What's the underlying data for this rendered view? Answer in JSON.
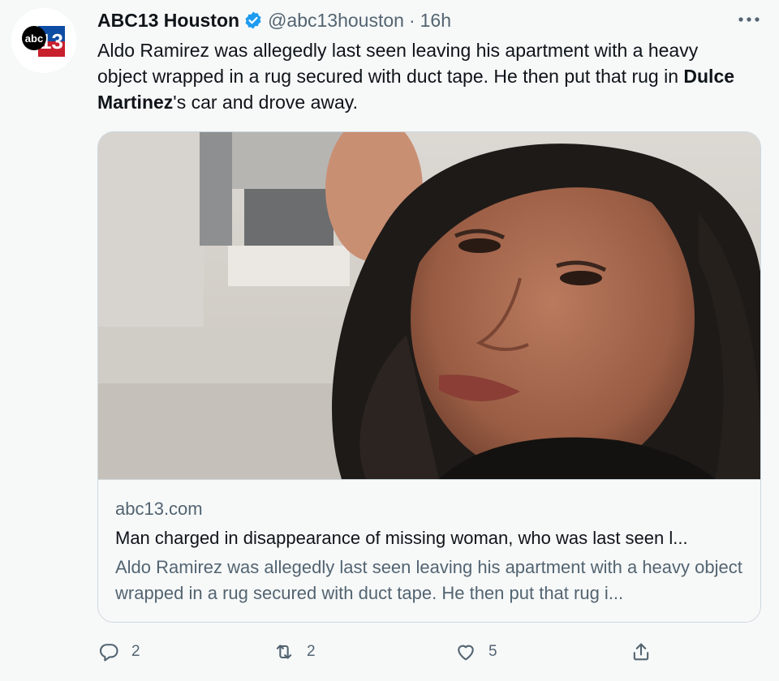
{
  "account": {
    "display_name": "ABC13 Houston",
    "handle": "@abc13houston",
    "separator": "·",
    "time": "16h",
    "avatar_logo_text": "abc13",
    "avatar_icon": "abc13-logo-icon",
    "verified_icon": "verified-badge-icon",
    "verified_color": "#1d9bf0"
  },
  "tweet": {
    "text_part1": "Aldo Ramirez was allegedly last seen leaving his apartment with a heavy object wrapped in a rug secured with duct tape. He then put that rug in ",
    "text_mention": "Dulce Martinez",
    "text_part2": "'s car and drove away."
  },
  "card": {
    "image_icon": "woman-photo-image",
    "domain": "abc13.com",
    "title": "Man charged in disappearance of missing woman, who was last seen l...",
    "description": "Aldo Ramirez was allegedly last seen leaving his apartment with a heavy object wrapped in a rug secured with duct tape. He then put that rug i..."
  },
  "actions": {
    "reply": {
      "icon": "reply-icon",
      "count": "2"
    },
    "retweet": {
      "icon": "retweet-icon",
      "count": "2"
    },
    "like": {
      "icon": "heart-icon",
      "count": "5"
    },
    "share": {
      "icon": "share-icon",
      "count": ""
    }
  },
  "more_icon": "more-options-icon",
  "colors": {
    "background": "#f7f9f9",
    "text_primary": "#0f1419",
    "text_secondary": "#536471",
    "border": "#cfd9de",
    "abc13_red": "#c8202c",
    "abc13_blue": "#0e4da4"
  }
}
